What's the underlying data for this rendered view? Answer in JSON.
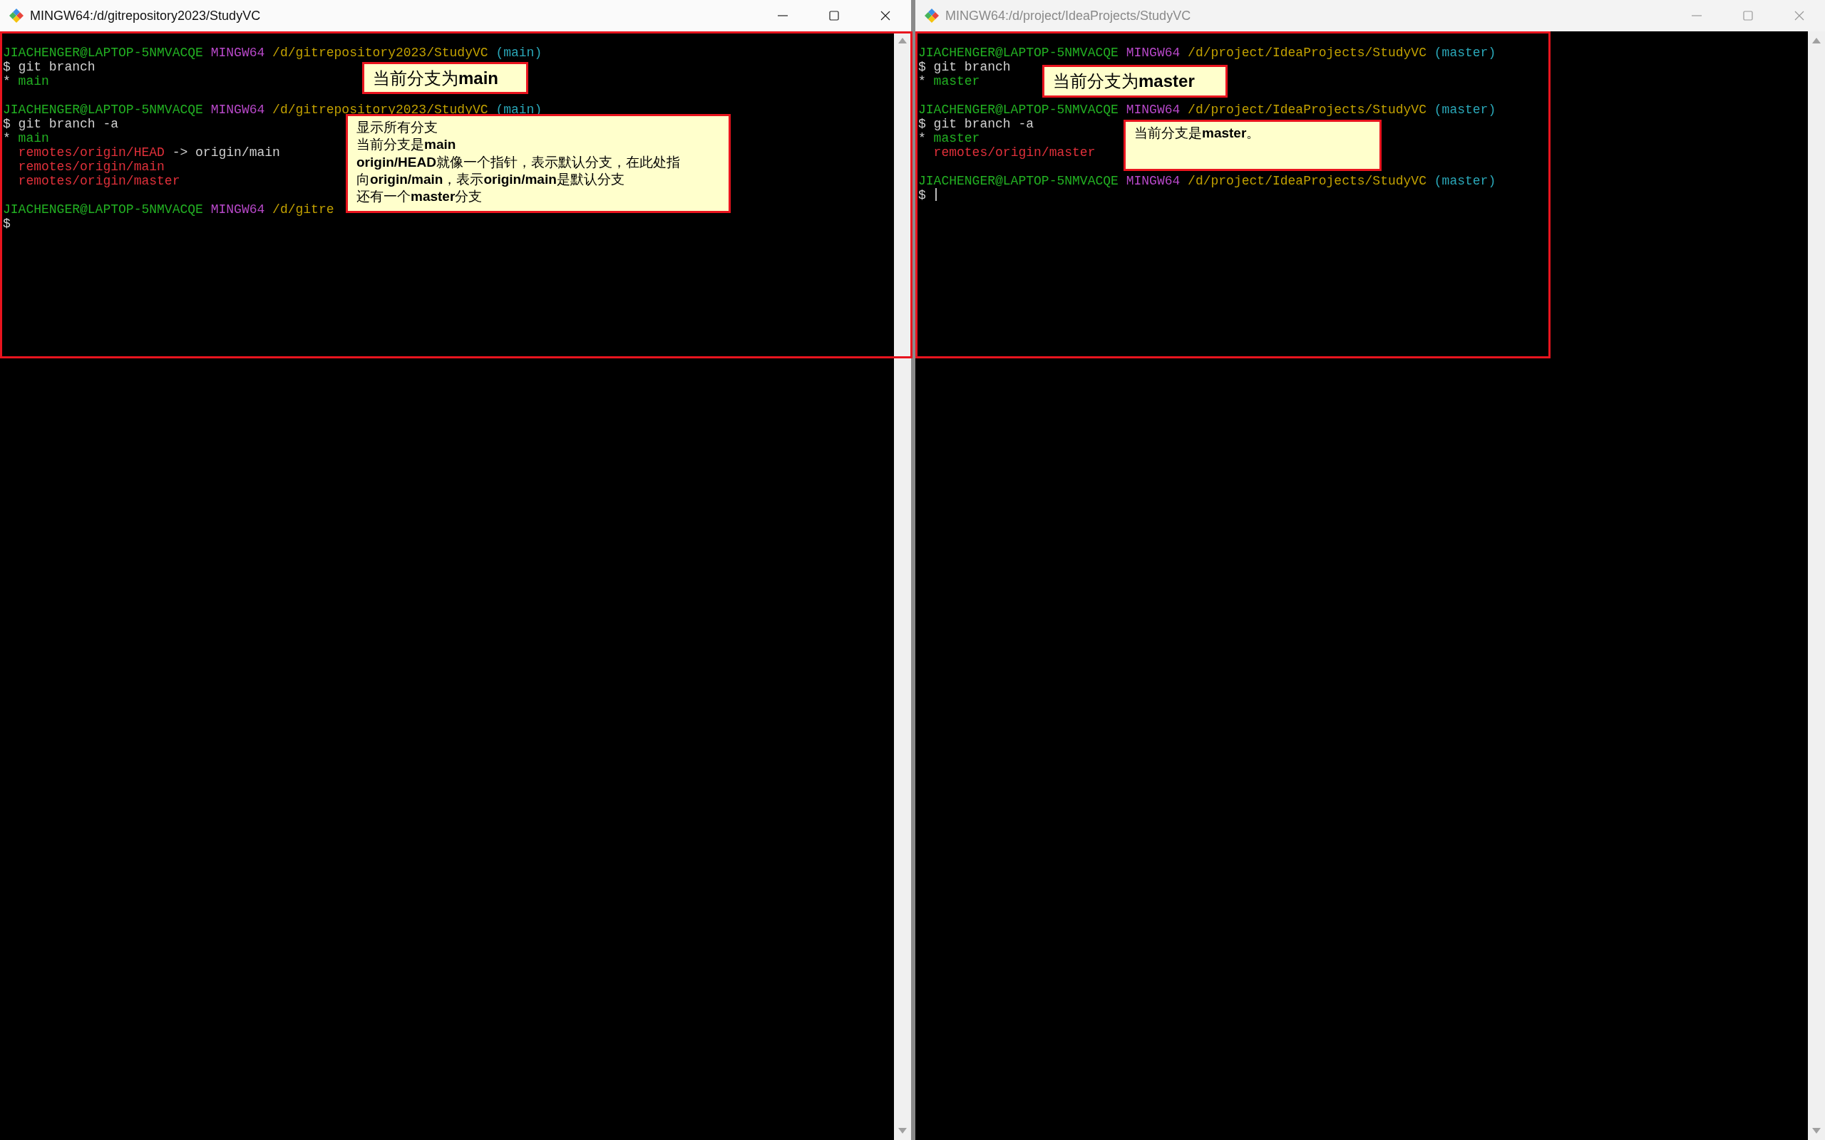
{
  "windows": [
    {
      "title": "MINGW64:/d/gitrepository2023/StudyVC",
      "active": true,
      "blocks": [
        {
          "prompt": {
            "user": "JIACHENGER@LAPTOP-5NMVACQE",
            "shell": "MINGW64",
            "path": "/d/gitrepository2023/StudyVC",
            "branch": "(main)"
          },
          "command": "$ git branch",
          "output": [
            {
              "kind": "current",
              "marker": "*",
              "text": "main"
            }
          ]
        },
        {
          "prompt": {
            "user": "JIACHENGER@LAPTOP-5NMVACQE",
            "shell": "MINGW64",
            "path": "/d/gitrepository2023/StudyVC",
            "branch": "(main)"
          },
          "command": "$ git branch -a",
          "output": [
            {
              "kind": "current",
              "marker": "*",
              "text": "main"
            },
            {
              "kind": "remote",
              "text": "remotes/origin/HEAD",
              "target": "-> origin/main"
            },
            {
              "kind": "remote",
              "text": "remotes/origin/main"
            },
            {
              "kind": "remote",
              "text": "remotes/origin/master"
            }
          ]
        },
        {
          "prompt": {
            "user": "JIACHENGER@LAPTOP-5NMVACQE",
            "shell": "MINGW64",
            "path": "/d/gitre"
          },
          "command": "$"
        }
      ],
      "notes": [
        {
          "lines": [
            "当前分支为**main**"
          ]
        },
        {
          "lines": [
            "显示所有分支",
            "当前分支是**main**",
            "**origin/HEAD**就像一个指针，表示默认分支，在此处指",
            "向**origin/main**，表示**origin/main**是默认分支",
            "还有一个**master**分支"
          ]
        }
      ]
    },
    {
      "title": "MINGW64:/d/project/IdeaProjects/StudyVC",
      "active": false,
      "blocks": [
        {
          "prompt": {
            "user": "JIACHENGER@LAPTOP-5NMVACQE",
            "shell": "MINGW64",
            "path": "/d/project/IdeaProjects/StudyVC",
            "branch": "(master)"
          },
          "command": "$ git branch",
          "output": [
            {
              "kind": "current",
              "marker": "*",
              "text": "master"
            }
          ]
        },
        {
          "prompt": {
            "user": "JIACHENGER@LAPTOP-5NMVACQE",
            "shell": "MINGW64",
            "path": "/d/project/IdeaProjects/StudyVC",
            "branch": "(master)"
          },
          "command": "$ git branch -a",
          "output": [
            {
              "kind": "current",
              "marker": "*",
              "text": "master"
            },
            {
              "kind": "remote",
              "text": "remotes/origin/master"
            }
          ]
        },
        {
          "prompt": {
            "user": "JIACHENGER@LAPTOP-5NMVACQE",
            "shell": "MINGW64",
            "path": "/d/project/IdeaProjects/StudyVC",
            "branch": "(master)"
          },
          "command": "$",
          "cursor": true
        }
      ],
      "notes": [
        {
          "lines": [
            "当前分支为**master**"
          ]
        },
        {
          "lines": [
            "当前分支是**master**。"
          ]
        }
      ]
    }
  ]
}
